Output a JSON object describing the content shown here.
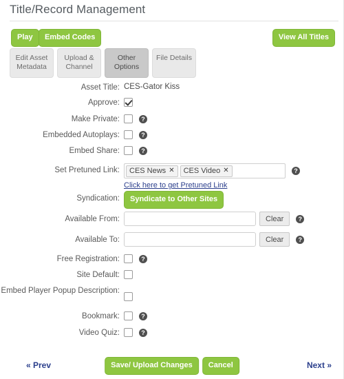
{
  "header": {
    "title": "Title/Record Management",
    "play_label": "Play",
    "embed_codes_label": "Embed Codes",
    "view_all_titles_label": "View All Titles"
  },
  "tabs": [
    {
      "label": "Edit Asset Metadata",
      "active": false
    },
    {
      "label": "Upload & Channel",
      "active": false
    },
    {
      "label": "Other Options",
      "active": true
    },
    {
      "label": "File Details",
      "active": false
    }
  ],
  "form": {
    "asset_title": {
      "label": "Asset Title:",
      "value": "CES-Gator Kiss"
    },
    "approve": {
      "label": "Approve:",
      "checked": true
    },
    "make_private": {
      "label": "Make Private:",
      "checked": false,
      "help": "?"
    },
    "embedded_autoplays": {
      "label": "Embedded Autoplays:",
      "checked": false,
      "help": "?"
    },
    "embed_share": {
      "label": "Embed Share:",
      "checked": false,
      "help": "?"
    },
    "set_pretuned_link": {
      "label": "Set Pretuned Link:",
      "tags": [
        "CES News",
        "CES Video"
      ],
      "tag_remove_glyph": "✕",
      "input_value": "",
      "input_placeholder": "",
      "link_text": "Click here to get Pretuned Link",
      "help": "?"
    },
    "syndication": {
      "label": "Syndication:",
      "button_label": "Syndicate to Other Sites"
    },
    "available_from": {
      "label": "Available From:",
      "value": "",
      "placeholder": "",
      "clear_label": "Clear",
      "help": "?"
    },
    "available_to": {
      "label": "Available To:",
      "value": "",
      "placeholder": "",
      "clear_label": "Clear",
      "help": "?"
    },
    "free_registration": {
      "label": "Free Registration:",
      "checked": false,
      "help": "?"
    },
    "site_default": {
      "label": "Site Default:",
      "checked": false
    },
    "embed_player_popup_description": {
      "label": "Embed Player Popup Description:",
      "checked": false
    },
    "bookmark": {
      "label": "Bookmark:",
      "checked": false,
      "help": "?"
    },
    "video_quiz": {
      "label": "Video Quiz:",
      "checked": false,
      "help": "?"
    }
  },
  "footer": {
    "prev_label": "« Prev",
    "next_label": "Next »",
    "save_label": "Save/ Upload Changes",
    "cancel_label": "Cancel"
  },
  "colors": {
    "green": "#8ec641",
    "green_border": "#7fb636",
    "tab_active": "#c9c9c9",
    "tab_inactive": "#e9e9e9",
    "link": "#2b3f8c",
    "label_text": "#595959"
  }
}
